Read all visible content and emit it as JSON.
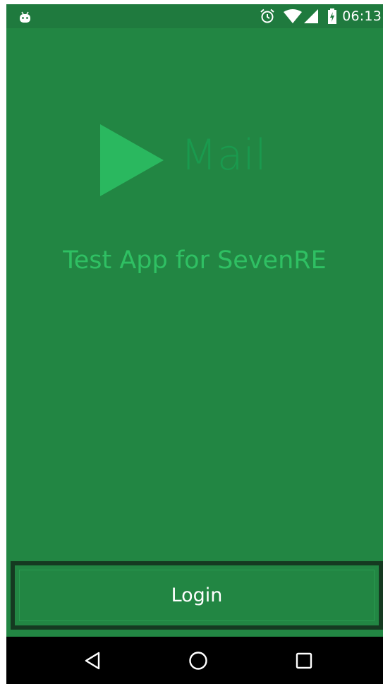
{
  "colors": {
    "status_bar": "#1f7a3e",
    "app_background": "#228643",
    "logo": "#1a9a4e",
    "logo_arrow": "#2ab85f",
    "tagline": "#2fc063",
    "button_border": "#153a21",
    "nav_bar": "#000000"
  },
  "status_bar": {
    "left_icon": "android-icon",
    "icons": [
      "alarm-icon",
      "wifi-icon",
      "signal-icon",
      "battery-charging-icon"
    ],
    "time": "06:13"
  },
  "app": {
    "logo_icon": "play-arrow-icon",
    "logo_text": "Mail",
    "tagline": "Test App for SevenRE",
    "login_label": "Login"
  },
  "nav_bar": {
    "buttons": [
      "back-icon",
      "home-icon",
      "recents-icon"
    ]
  }
}
